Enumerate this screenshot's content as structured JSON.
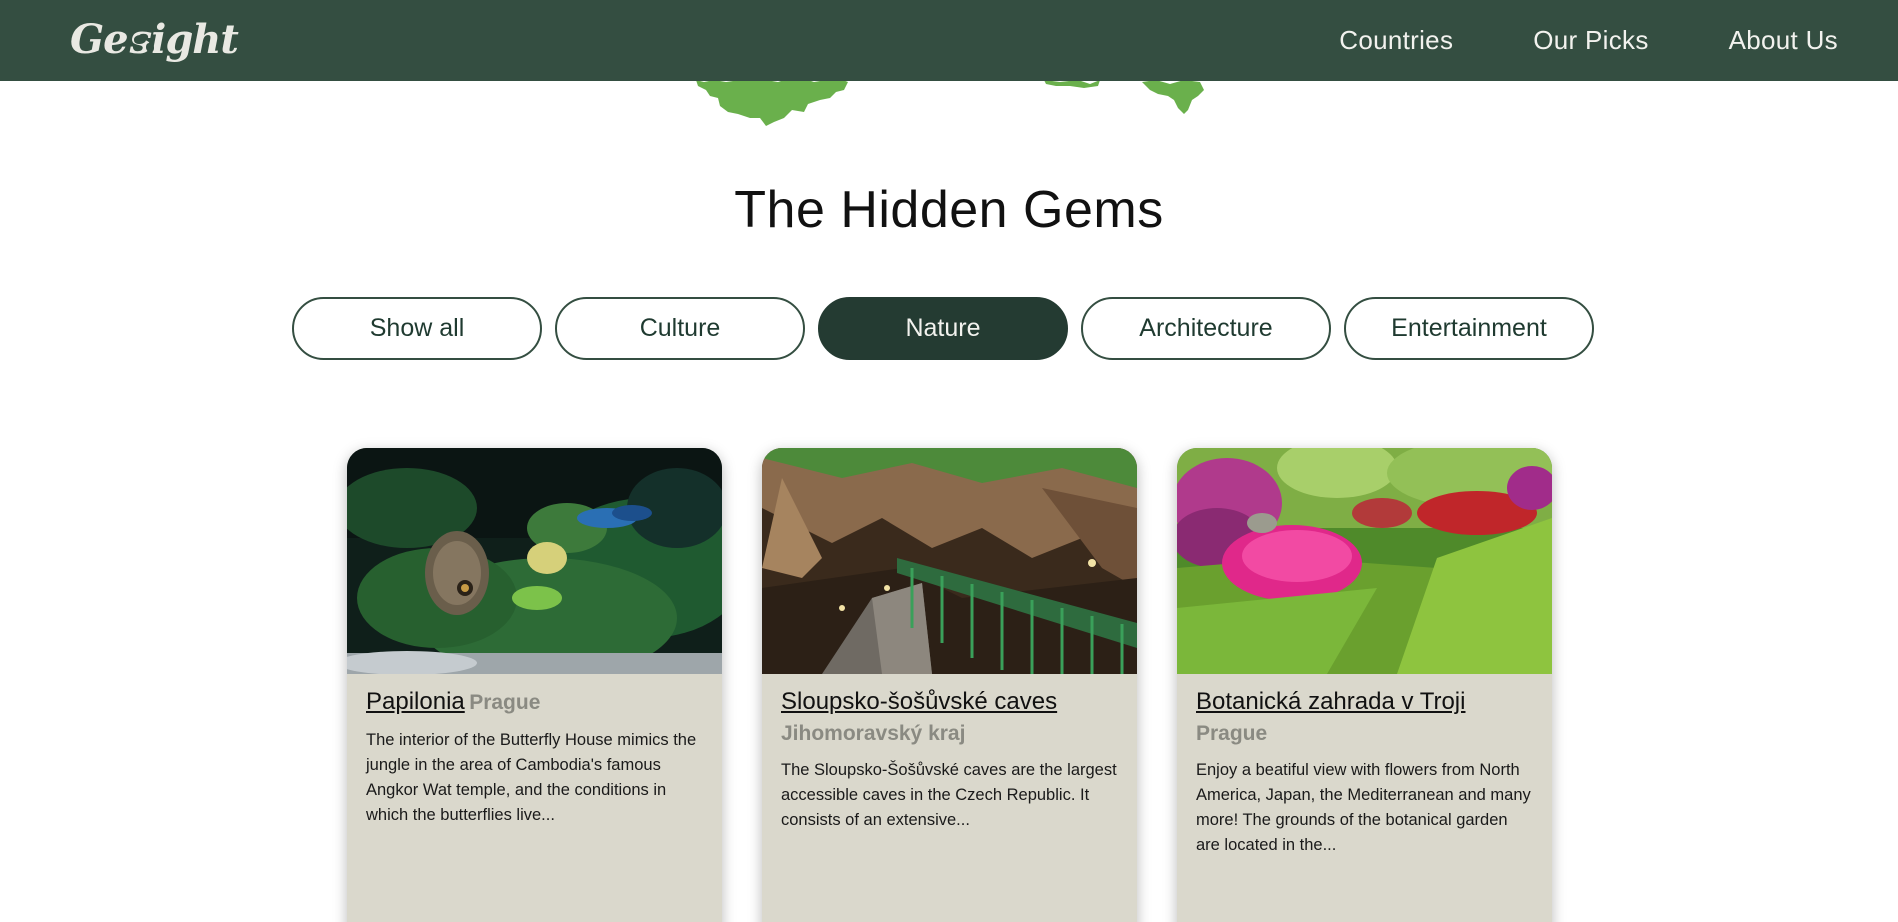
{
  "navbar": {
    "logo_text_left": "Ge",
    "logo_text_right": "sight",
    "links": [
      {
        "label": "Countries"
      },
      {
        "label": "Our Picks"
      },
      {
        "label": "About Us"
      }
    ]
  },
  "section": {
    "title": "The Hidden Gems"
  },
  "filters": [
    {
      "label": "Show all",
      "active": false
    },
    {
      "label": "Culture",
      "active": false
    },
    {
      "label": "Nature",
      "active": true
    },
    {
      "label": "Architecture",
      "active": false
    },
    {
      "label": "Entertainment",
      "active": false
    }
  ],
  "cards": [
    {
      "title": "Papilonia",
      "location": "Prague",
      "description": "The interior of the Butterfly House mimics the jungle in the area of Cambodia's famous Angkor Wat temple, and the conditions in which the butterflies live..."
    },
    {
      "title": "Sloupsko-šošůvské caves",
      "location": "Jihomoravský kraj",
      "description": "The Sloupsko-Šošůvské caves are the largest accessible caves in the Czech Republic. It consists of an extensive..."
    },
    {
      "title": "Botanická zahrada v Troji",
      "location": "Prague",
      "description": "Enjoy a beatiful view with flowers from North America, Japan, the Mediterranean and many more! The grounds of the botanical garden are located in the..."
    }
  ],
  "colors": {
    "nav_bg": "#344e41",
    "active_filter": "#243b32",
    "card_bg": "#dad8cc",
    "map_green": "#6ab04c"
  }
}
